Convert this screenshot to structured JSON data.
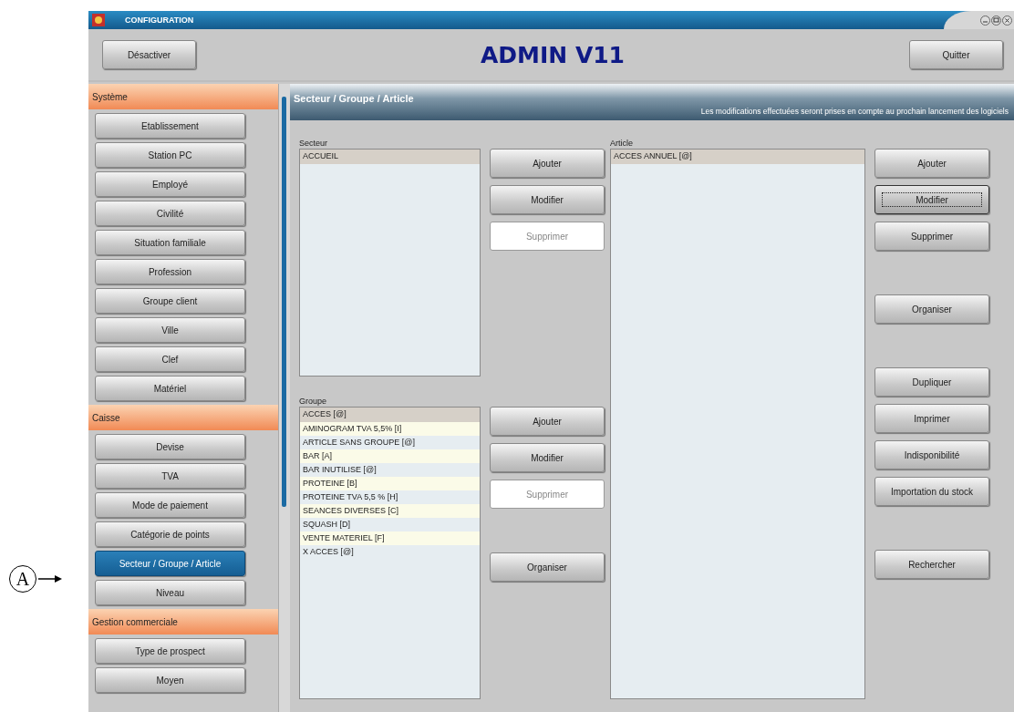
{
  "window": {
    "title": "CONFIGURATION"
  },
  "toolbar": {
    "left_button": "Désactiver",
    "heading": "ADMIN V11",
    "right_button": "Quitter"
  },
  "sidebar": {
    "sections": [
      {
        "title": "Système",
        "items": [
          {
            "label": "Etablissement",
            "selected": false
          },
          {
            "label": "Station PC",
            "selected": false
          },
          {
            "label": "Employé",
            "selected": false
          },
          {
            "label": "Civilité",
            "selected": false
          },
          {
            "label": "Situation familiale",
            "selected": false
          },
          {
            "label": "Profession",
            "selected": false
          },
          {
            "label": "Groupe client",
            "selected": false
          },
          {
            "label": "Ville",
            "selected": false
          },
          {
            "label": "Clef",
            "selected": false
          },
          {
            "label": "Matériel",
            "selected": false
          }
        ]
      },
      {
        "title": "Caisse",
        "items": [
          {
            "label": "Devise",
            "selected": false
          },
          {
            "label": "TVA",
            "selected": false
          },
          {
            "label": "Mode de paiement",
            "selected": false
          },
          {
            "label": "Catégorie de points",
            "selected": false
          },
          {
            "label": "Secteur / Groupe / Article",
            "selected": true
          },
          {
            "label": "Niveau",
            "selected": false
          }
        ]
      },
      {
        "title": "Gestion commerciale",
        "items": [
          {
            "label": "Type de prospect",
            "selected": false
          },
          {
            "label": "Moyen",
            "selected": false
          }
        ]
      }
    ]
  },
  "panel": {
    "title": "Secteur / Groupe / Article",
    "note": "Les modifications effectuées seront prises en compte au prochain lancement des logiciels"
  },
  "secteur": {
    "label": "Secteur",
    "items": [
      {
        "text": "ACCUEIL",
        "selected": true
      }
    ],
    "buttons": [
      {
        "label": "Ajouter",
        "disabled": false
      },
      {
        "label": "Modifier",
        "disabled": false
      },
      {
        "label": "Supprimer",
        "disabled": true
      }
    ]
  },
  "groupe": {
    "label": "Groupe",
    "items": [
      {
        "text": "ACCES [@]",
        "selected": true
      },
      {
        "text": "AMINOGRAM TVA 5,5% [I]",
        "selected": false
      },
      {
        "text": "ARTICLE SANS GROUPE [@]",
        "selected": false
      },
      {
        "text": "BAR [A]",
        "selected": false
      },
      {
        "text": "BAR INUTILISE [@]",
        "selected": false
      },
      {
        "text": "PROTEINE [B]",
        "selected": false
      },
      {
        "text": "PROTEINE TVA 5,5 % [H]",
        "selected": false
      },
      {
        "text": "SEANCES DIVERSES [C]",
        "selected": false
      },
      {
        "text": "SQUASH [D]",
        "selected": false
      },
      {
        "text": "VENTE MATERIEL [F]",
        "selected": false
      },
      {
        "text": "X ACCES [@]",
        "selected": false
      }
    ],
    "buttons": [
      {
        "label": "Ajouter",
        "disabled": false
      },
      {
        "label": "Modifier",
        "disabled": false
      },
      {
        "label": "Supprimer",
        "disabled": true
      },
      {
        "label": "Organiser",
        "disabled": false
      }
    ]
  },
  "article": {
    "label": "Article",
    "items": [
      {
        "text": "ACCES ANNUEL [@]",
        "selected": true
      }
    ],
    "buttons": [
      {
        "label": "Ajouter",
        "focused": false
      },
      {
        "label": "Modifier",
        "focused": true
      },
      {
        "label": "Supprimer",
        "focused": false
      },
      {
        "label": "Organiser",
        "focused": false
      },
      {
        "label": "Dupliquer",
        "focused": false
      },
      {
        "label": "Imprimer",
        "focused": false
      },
      {
        "label": "Indisponibilité",
        "focused": false
      },
      {
        "label": "Importation du stock",
        "focused": false
      },
      {
        "label": "Rechercher",
        "focused": false
      }
    ]
  },
  "callout": {
    "label": "A"
  }
}
